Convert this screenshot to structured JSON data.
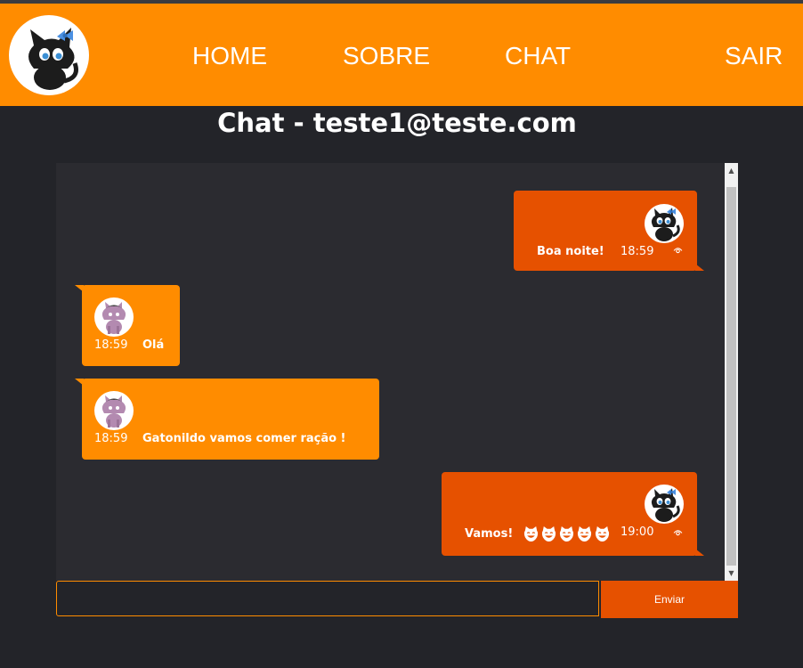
{
  "nav": {
    "links": [
      "HOME",
      "SOBRE",
      "CHAT",
      "SAIR"
    ]
  },
  "page_title": "Chat - teste1@teste.com",
  "messages": [
    {
      "direction": "sent",
      "text": "Boa noite!",
      "time": "18:59",
      "avatar": "black-cat-with-blue-bow",
      "seen_icon": "eye-icon"
    },
    {
      "direction": "received",
      "text": "Olá",
      "time": "18:59",
      "avatar": "purple-cat"
    },
    {
      "direction": "received",
      "text": "Gatonildo vamos comer ração !",
      "time": "18:59",
      "avatar": "purple-cat"
    },
    {
      "direction": "sent",
      "text": "Vamos!",
      "emojis": [
        "smiling-cat",
        "smiling-cat",
        "smiling-cat",
        "smiling-cat",
        "smiling-cat"
      ],
      "time": "19:00",
      "avatar": "black-cat-with-blue-bow",
      "seen_icon": "eye-icon"
    }
  ],
  "composer": {
    "input_value": "",
    "send_label": "Enviar"
  },
  "colors": {
    "brand_orange": "#ff8c00",
    "sent_bubble": "#e65100",
    "background": "#232429",
    "chat_panel": "#2b2b30"
  }
}
